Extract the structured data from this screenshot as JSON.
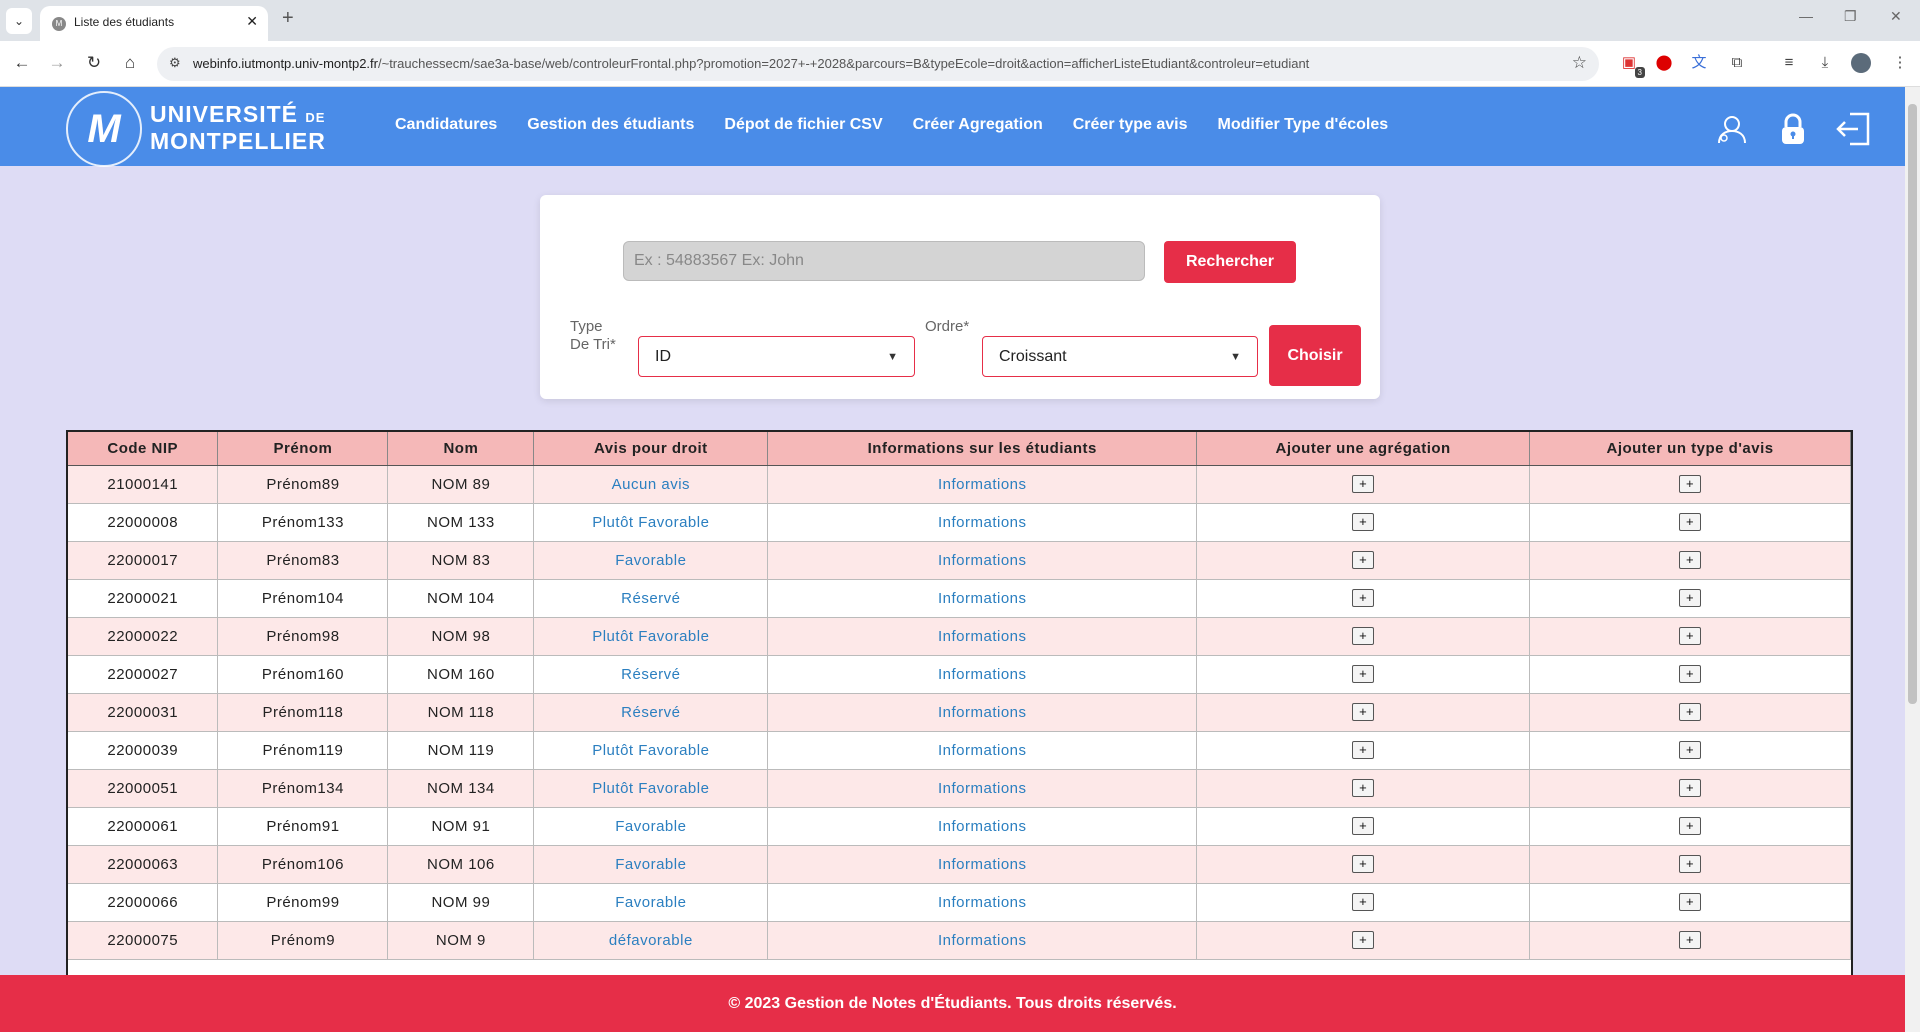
{
  "browser": {
    "tab_title": "Liste des étudiants",
    "url_host": "webinfo.iutmontp.univ-montp2.fr",
    "url_path": "/~trauchessecm/sae3a-base/web/controleurFrontal.php?promotion=2027+-+2028&parcours=B&typeEcole=droit&action=afficherListeEtudiant&controleur=etudiant",
    "extension_badge": "3"
  },
  "header": {
    "logo_line1": "UNIVERSITÉ",
    "logo_de": "DE",
    "logo_line2": "MONTPELLIER",
    "nav": [
      "Candidatures",
      "Gestion des étudiants",
      "Dépot de fichier CSV",
      "Créer Agregation",
      "Créer type avis",
      "Modifier Type d'écoles"
    ],
    "icons": [
      "user-settings-icon",
      "lock-icon",
      "logout-icon"
    ]
  },
  "search": {
    "placeholder": "Ex : 54883567 Ex: John",
    "value": "",
    "search_button": "Rechercher",
    "sort_type_label_1": "Type",
    "sort_type_label_2": "De Tri*",
    "sort_type_value": "ID",
    "order_label": "Ordre*",
    "order_value": "Croissant",
    "choose_button": "Choisir"
  },
  "table": {
    "columns": [
      "Code NIP",
      "Prénom",
      "Nom",
      "Avis pour droit",
      "Informations sur les étudiants",
      "Ajouter une agrégation",
      "Ajouter un type d'avis"
    ],
    "rows": [
      {
        "nip": "21000141",
        "prenom": "Prénom89",
        "nom": "NOM 89",
        "avis": "Aucun avis",
        "info": "Informations"
      },
      {
        "nip": "22000008",
        "prenom": "Prénom133",
        "nom": "NOM 133",
        "avis": "Plutôt Favorable",
        "info": "Informations"
      },
      {
        "nip": "22000017",
        "prenom": "Prénom83",
        "nom": "NOM 83",
        "avis": "Favorable",
        "info": "Informations"
      },
      {
        "nip": "22000021",
        "prenom": "Prénom104",
        "nom": "NOM 104",
        "avis": "Réservé",
        "info": "Informations"
      },
      {
        "nip": "22000022",
        "prenom": "Prénom98",
        "nom": "NOM 98",
        "avis": "Plutôt Favorable",
        "info": "Informations"
      },
      {
        "nip": "22000027",
        "prenom": "Prénom160",
        "nom": "NOM 160",
        "avis": "Réservé",
        "info": "Informations"
      },
      {
        "nip": "22000031",
        "prenom": "Prénom118",
        "nom": "NOM 118",
        "avis": "Réservé",
        "info": "Informations"
      },
      {
        "nip": "22000039",
        "prenom": "Prénom119",
        "nom": "NOM 119",
        "avis": "Plutôt Favorable",
        "info": "Informations"
      },
      {
        "nip": "22000051",
        "prenom": "Prénom134",
        "nom": "NOM 134",
        "avis": "Plutôt Favorable",
        "info": "Informations"
      },
      {
        "nip": "22000061",
        "prenom": "Prénom91",
        "nom": "NOM 91",
        "avis": "Favorable",
        "info": "Informations"
      },
      {
        "nip": "22000063",
        "prenom": "Prénom106",
        "nom": "NOM 106",
        "avis": "Favorable",
        "info": "Informations"
      },
      {
        "nip": "22000066",
        "prenom": "Prénom99",
        "nom": "NOM 99",
        "avis": "Favorable",
        "info": "Informations"
      },
      {
        "nip": "22000075",
        "prenom": "Prénom9",
        "nom": "NOM 9",
        "avis": "défavorable",
        "info": "Informations"
      }
    ],
    "add_symbol": "+"
  },
  "footer": {
    "text": "© 2023 Gestion de Notes d'Étudiants. Tous droits réservés."
  },
  "colors": {
    "header_blue": "#4a8ce8",
    "accent_red": "#e62e48",
    "table_header_pink": "#f5b8b8",
    "row_pink": "#fde8e8",
    "link_blue": "#2b7fc0",
    "page_bg": "#dedcf5"
  }
}
